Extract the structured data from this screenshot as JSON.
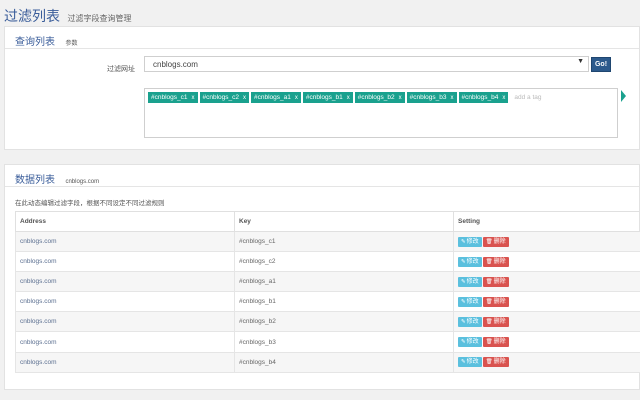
{
  "header": {
    "title": "过滤列表",
    "subtitle": "过滤字段查询管理"
  },
  "query_panel": {
    "title": "查询列表",
    "subtitle": "参数",
    "form_label": "过滤网址",
    "select_value": "cnblogs.com",
    "go_label": "Go!",
    "tags": [
      {
        "label": "#cnblogs_c1",
        "remove": "x"
      },
      {
        "label": "#cnblogs_c2",
        "remove": "x"
      },
      {
        "label": "#cnblogs_a1",
        "remove": "x"
      },
      {
        "label": "#cnblogs_b1",
        "remove": "x"
      },
      {
        "label": "#cnblogs_b2",
        "remove": "x"
      },
      {
        "label": "#cnblogs_b3",
        "remove": "x"
      },
      {
        "label": "#cnblogs_b4",
        "remove": "x"
      }
    ],
    "tag_placeholder": "add a tag"
  },
  "data_panel": {
    "title": "数据列表",
    "subtitle": "cnblogs.com",
    "description": "在此动态编辑过滤字段，根据不同设定不同过滤规则",
    "columns": [
      "Address",
      "Key",
      "Setting"
    ],
    "edit_label": "修改",
    "delete_label": "删除",
    "rows": [
      {
        "address": "cnblogs.com",
        "key": "#cnblogs_c1"
      },
      {
        "address": "cnblogs.com",
        "key": "#cnblogs_c2"
      },
      {
        "address": "cnblogs.com",
        "key": "#cnblogs_a1"
      },
      {
        "address": "cnblogs.com",
        "key": "#cnblogs_b1"
      },
      {
        "address": "cnblogs.com",
        "key": "#cnblogs_b2"
      },
      {
        "address": "cnblogs.com",
        "key": "#cnblogs_b3"
      },
      {
        "address": "cnblogs.com",
        "key": "#cnblogs_b4"
      }
    ]
  },
  "icons": {
    "edit": "pencil-icon",
    "delete": "trash-icon",
    "dropdown": "caret-down-icon",
    "scroll_hint": "arrow-right-icon"
  },
  "colors": {
    "accent": "#3a5d9a",
    "tag": "#1aa18e",
    "go_button": "#2c5a8c",
    "edit_button": "#5bc0de",
    "delete_button": "#d9534f"
  }
}
